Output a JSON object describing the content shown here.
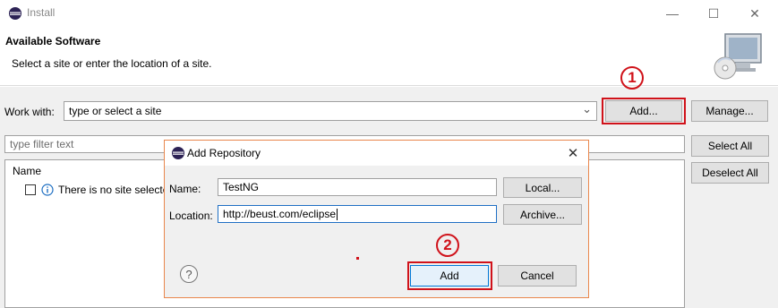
{
  "window": {
    "title": "Install",
    "minimize_glyph": "—",
    "maximize_glyph": "☐",
    "close_glyph": "✕"
  },
  "header": {
    "title": "Available Software",
    "subtitle": "Select a site or enter the location of a site."
  },
  "work_with": {
    "label": "Work with:",
    "value": "type or select a site",
    "dropdown_glyph": "⌄",
    "add_label": "Add...",
    "manage_label": "Manage..."
  },
  "filter": {
    "placeholder": "type filter text"
  },
  "list": {
    "column_name": "Name",
    "empty_message": "There is no site selecte",
    "select_all_label": "Select All",
    "deselect_all_label": "Deselect All"
  },
  "dialog": {
    "title": "Add Repository",
    "close_glyph": "✕",
    "name_label": "Name:",
    "name_value": "TestNG",
    "local_label": "Local...",
    "location_label": "Location:",
    "location_value": "http://beust.com/eclipse",
    "archive_label": "Archive...",
    "help_glyph": "?",
    "add_label": "Add",
    "cancel_label": "Cancel"
  },
  "annotations": {
    "step1": "1",
    "step2": "2",
    "color": "#d0121a"
  }
}
